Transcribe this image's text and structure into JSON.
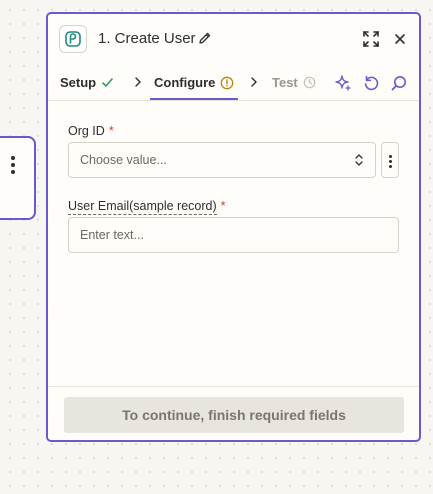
{
  "header": {
    "title": "1. Create User",
    "app_icon": "app-logo-icon",
    "edit_icon": "pencil-icon",
    "expand_icon": "expand-icon",
    "close_icon": "close-icon"
  },
  "tabs": [
    {
      "label": "Setup",
      "status_icon": "check-icon",
      "status_color": "#2f9e63"
    },
    {
      "label": "Configure",
      "status_icon": "warning-icon",
      "status_color": "#b8860b",
      "active": true
    },
    {
      "label": "Test",
      "status_icon": "clock-icon",
      "status_color": "#c4c0b8"
    }
  ],
  "toolbar": {
    "ai_icon": "sparkle-icon",
    "refresh_icon": "refresh-icon",
    "search_icon": "search-icon"
  },
  "fields": {
    "org_id": {
      "label": "Org ID",
      "required_mark": "*",
      "placeholder": "Choose value..."
    },
    "user_email": {
      "label": "User Email(sample record)",
      "required_mark": "*",
      "placeholder": "Enter text..."
    }
  },
  "footer": {
    "continue_label": "To continue, finish required fields"
  },
  "colors": {
    "accent": "#6a5acd",
    "required": "#d93b2b",
    "disabled_button": "#e8e5de"
  }
}
